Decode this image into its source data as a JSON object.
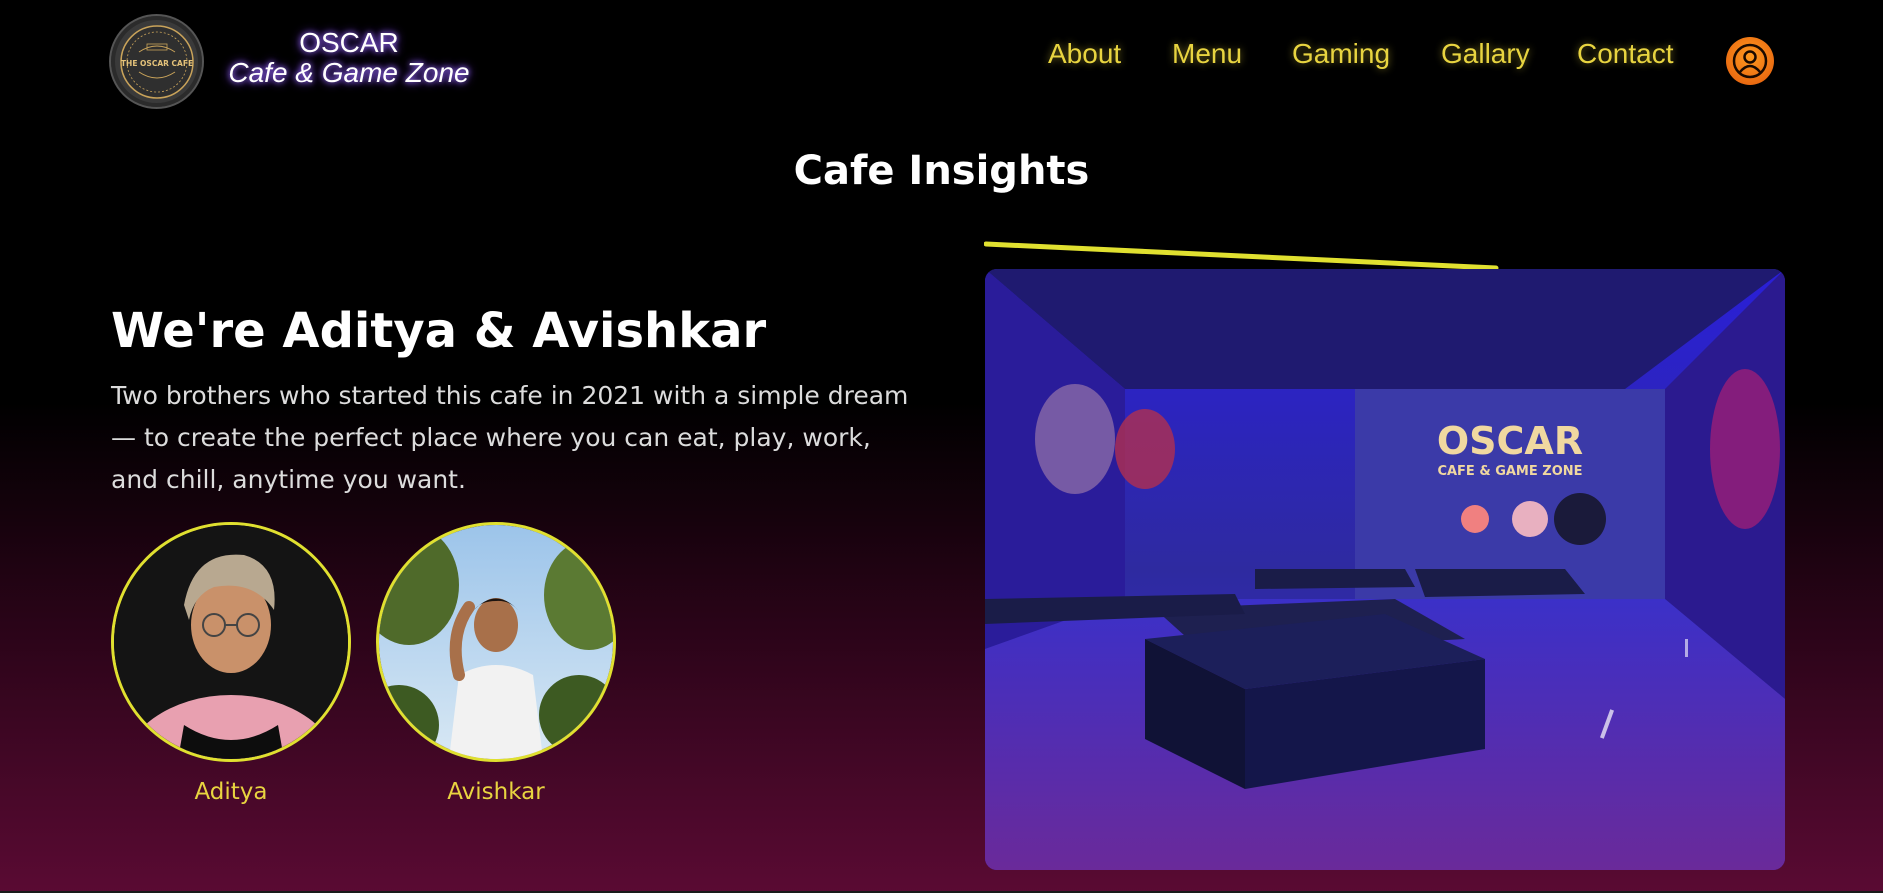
{
  "header": {
    "logo": {
      "icon": "oscar-cafe-logo",
      "text": "THE OSCAR CAFE"
    },
    "brand_name": "OSCAR",
    "brand_tagline": "Cafe & Game Zone",
    "nav": [
      "About",
      "Menu",
      "Gaming",
      "Gallary",
      "Contact"
    ],
    "profile_icon": "user-icon"
  },
  "main": {
    "section_title": "Cafe Insights",
    "heading": "We're Aditya & Avishkar",
    "description": "Two brothers who started this cafe in 2021 with a simple dream — to create the perfect place where you can eat, play, work, and chill, anytime you want.",
    "founders": [
      {
        "name": "Aditya"
      },
      {
        "name": "Avishkar"
      }
    ],
    "photo": {
      "sign_title": "OSCAR",
      "sign_subtitle": "CAFE & GAME ZONE"
    }
  },
  "colors": {
    "accent_yellow": "#e8d440",
    "profile_orange": "#f07a16",
    "gradient_bottom": "#5a0a33"
  }
}
